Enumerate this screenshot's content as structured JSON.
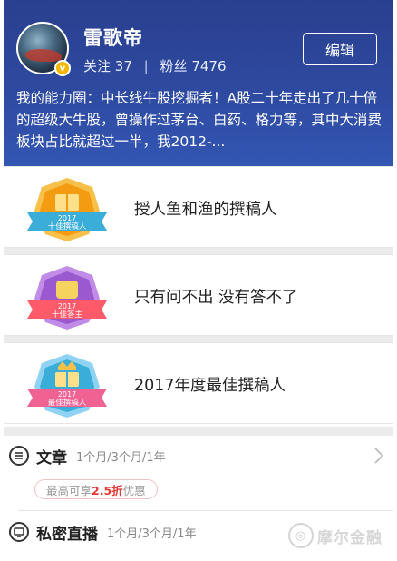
{
  "profile": {
    "avatar_text": "",
    "verified_badge": "v",
    "username": "雷歌帝",
    "following_label": "关注",
    "following_count": "37",
    "separator": "|",
    "followers_label": "粉丝",
    "followers_count": "7476",
    "edit_label": "编辑",
    "bio": "我的能力圈：中长线牛股挖掘者！A股二十年走出了几十倍的超级大牛股，曾操作过茅台、白药、格力等，其中大消费板块占比就超过一半，我2012-..."
  },
  "honors": [
    {
      "title": "授人鱼和渔的撰稿人",
      "badge_year": "2017",
      "badge_text": "十佳撰稿人",
      "badge_color": "#f39c12",
      "ribbon_color": "#3aaed8",
      "icon": "book-badge-icon"
    },
    {
      "title": "只有问不出 没有答不了",
      "badge_year": "2017",
      "badge_text": "十佳答主",
      "badge_color": "#9b59d0",
      "ribbon_color": "#ff5a6a",
      "icon": "answer-badge-icon"
    },
    {
      "title": "2017年度最佳撰稿人",
      "badge_year": "2017",
      "badge_text": "最佳撰稿人",
      "badge_color": "#3aaed8",
      "ribbon_color": "#f06292",
      "icon": "crown-book-badge-icon"
    }
  ],
  "services": {
    "article": {
      "name": "文章",
      "period": "1个月/3个月/1年",
      "discount_prefix": "最高可享",
      "discount_value": "2.5折",
      "discount_suffix": "优惠",
      "icon": "document-icon"
    },
    "live": {
      "name": "私密直播",
      "period": "1个月/3个月/1年",
      "icon": "tv-icon"
    }
  },
  "watermark": {
    "text": "摩尔金融",
    "icon": "moer-logo-icon"
  },
  "colors": {
    "header_bg": "#2e4aa0",
    "accent_red": "#e53935"
  }
}
